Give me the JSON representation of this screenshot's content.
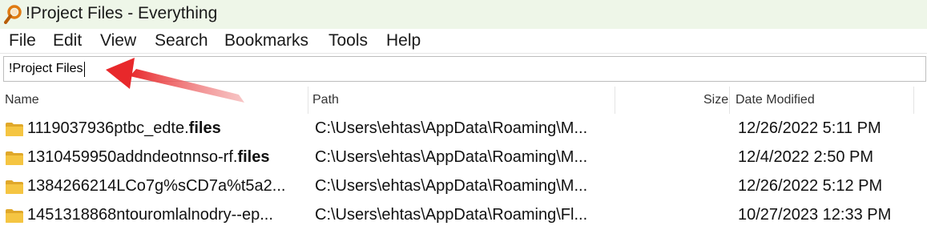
{
  "window": {
    "title": "!Project Files - Everything",
    "app_icon": "magnifier-icon",
    "icon_color": "#e07b12"
  },
  "menu": [
    "File",
    "Edit",
    "View",
    "Search",
    "Bookmarks",
    "Tools",
    "Help"
  ],
  "search": {
    "value": "!Project Files"
  },
  "annotation": {
    "type": "red-arrow-pointing-to-search-box",
    "color": "#e8282b"
  },
  "columns": {
    "name": "Name",
    "path": "Path",
    "size": "Size",
    "date": "Date Modified"
  },
  "rows": [
    {
      "name_main": "1119037936ptbc_edte.",
      "name_bold": "files",
      "path": "C:\\Users\\ehtas\\AppData\\Roaming\\M...",
      "date": "12/26/2022 5:11 PM"
    },
    {
      "name_main": "1310459950addndeotnnso-rf.",
      "name_bold": "files",
      "path": "C:\\Users\\ehtas\\AppData\\Roaming\\M...",
      "date": "12/4/2022 2:50 PM"
    },
    {
      "name_main": "1384266214LCo7g%sCD7a%t5a2...",
      "name_bold": "",
      "path": "C:\\Users\\ehtas\\AppData\\Roaming\\M...",
      "date": "12/26/2022 5:12 PM"
    },
    {
      "name_main": "1451318868ntouromlalnodry--ep...",
      "name_bold": "",
      "path": "C:\\Users\\ehtas\\AppData\\Roaming\\Fl...",
      "date": "10/27/2023 12:33 PM"
    }
  ],
  "colors": {
    "titlebar_bg": "#eef6e8",
    "folder_fill": "#f5c542",
    "folder_dark": "#e0a82a"
  }
}
